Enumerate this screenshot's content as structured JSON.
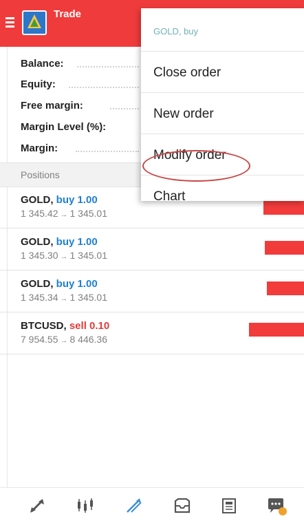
{
  "header": {
    "title": "Trade"
  },
  "account": {
    "balance_label": "Balance:",
    "equity_label": "Equity:",
    "free_margin_label": "Free margin:",
    "margin_level_label": "Margin Level (%):",
    "margin_label": "Margin:"
  },
  "positions_header": "Positions",
  "positions": [
    {
      "symbol": "GOLD,",
      "side": "buy",
      "volume": "1.00",
      "open": "1 345.42",
      "arrow": "→",
      "current": "1 345.01"
    },
    {
      "symbol": "GOLD,",
      "side": "buy",
      "volume": "1.00",
      "open": "1 345.30",
      "arrow": "→",
      "current": "1 345.01"
    },
    {
      "symbol": "GOLD,",
      "side": "buy",
      "volume": "1.00",
      "open": "1 345.34",
      "arrow": "→",
      "current": "1 345.01"
    },
    {
      "symbol": "BTCUSD,",
      "side": "sell",
      "volume": "0.10",
      "open": "7 954.55",
      "arrow": "→",
      "current": "8 446.36"
    }
  ],
  "context_menu": {
    "title": "GOLD, buy",
    "items": [
      "Close order",
      "New order",
      "Modify order",
      "Chart"
    ],
    "highlighted_item": "Modify order"
  },
  "bottom_nav": [
    {
      "icon": "quotes-icon"
    },
    {
      "icon": "chart-icon"
    },
    {
      "icon": "trade-icon",
      "active": true
    },
    {
      "icon": "history-icon"
    },
    {
      "icon": "news-icon"
    },
    {
      "icon": "messages-icon"
    }
  ],
  "colors": {
    "header": "#ef3b3b",
    "buy": "#1f7fd2",
    "sell": "#e43a3a",
    "highlight_circle": "#c94545",
    "menu_title": "#6fb1b7"
  }
}
